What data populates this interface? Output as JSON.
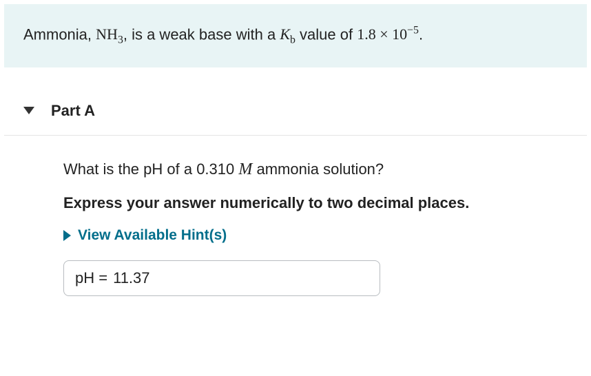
{
  "intro": {
    "pre": "Ammonia, ",
    "formula_main": "NH",
    "formula_sub": "3",
    "mid1": ", is a weak base with a ",
    "kb_K": "K",
    "kb_sub": "b",
    "mid2": " value of ",
    "value_base": "1.8 × 10",
    "value_exp": "−5",
    "tail": "."
  },
  "part": {
    "label": "Part A"
  },
  "question": {
    "q_pre": "What is the pH of a 0.310 ",
    "q_unit": "M",
    "q_post": " ammonia solution?"
  },
  "instruction": "Express your answer numerically to two decimal places.",
  "hints_label": "View Available Hint(s)",
  "answer": {
    "label": "pH = ",
    "value": "11.37"
  }
}
